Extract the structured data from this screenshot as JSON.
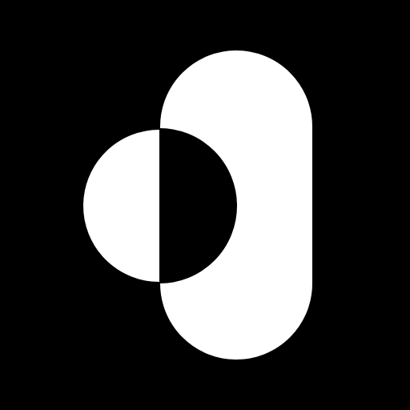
{
  "app_icon": {
    "icon": "overlapping-circle-and-pill-logo-icon",
    "colors": {
      "background": "#000000",
      "shape": "#ffffff",
      "cutout": "#000000"
    }
  }
}
